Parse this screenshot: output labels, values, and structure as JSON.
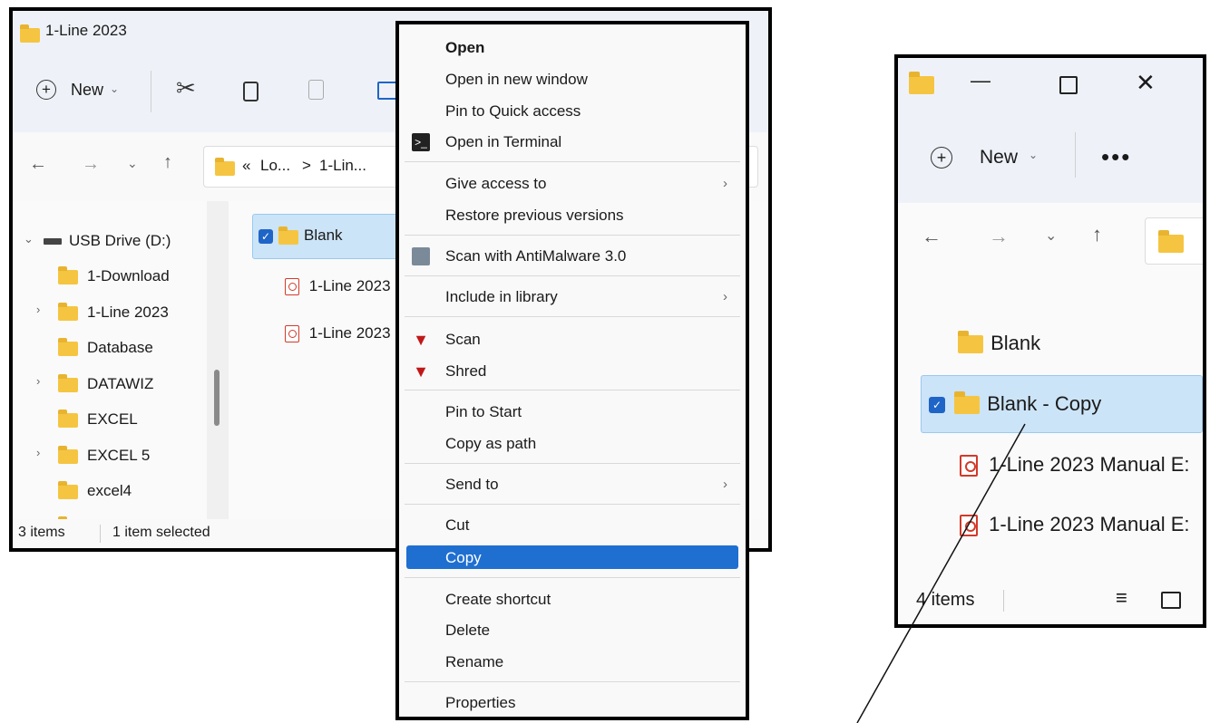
{
  "left_window": {
    "title": "1-Line 2023",
    "toolbar": {
      "new_label": "New"
    },
    "address": {
      "prefix": "«",
      "segment1": "Lo...",
      "separator": ">",
      "segment2": "1-Lin..."
    },
    "tree": [
      {
        "label": "USB Drive (D:)",
        "expandable": true,
        "expanded": true
      },
      {
        "label": "1-Download",
        "expandable": false
      },
      {
        "label": "1-Line 2023",
        "expandable": true
      },
      {
        "label": "Database",
        "expandable": false
      },
      {
        "label": "DATAWIZ",
        "expandable": true
      },
      {
        "label": "EXCEL",
        "expandable": false
      },
      {
        "label": "EXCEL 5",
        "expandable": true
      },
      {
        "label": "excel4",
        "expandable": false
      }
    ],
    "files": [
      {
        "name": "Blank",
        "type": "folder",
        "selected": true
      },
      {
        "name": "1-Line 2023",
        "type": "pdf"
      },
      {
        "name": "1-Line 2023",
        "type": "pdf"
      }
    ],
    "status": {
      "count": "3 items",
      "selected": "1 item selected"
    }
  },
  "context_menu": {
    "items": [
      {
        "label": "Open",
        "bold": true
      },
      {
        "label": "Open in new window"
      },
      {
        "label": "Pin to Quick access"
      },
      {
        "label": "Open in Terminal",
        "icon": "terminal-icon"
      },
      {
        "label": "Give access to",
        "submenu": true
      },
      {
        "label": "Restore previous versions"
      },
      {
        "label": "Scan with AntiMalware 3.0",
        "icon": "antimalware-icon"
      },
      {
        "label": "Include in library",
        "submenu": true
      },
      {
        "label": "Scan",
        "icon": "mcafee-icon"
      },
      {
        "label": "Shred",
        "icon": "mcafee-icon"
      },
      {
        "label": "Pin to Start"
      },
      {
        "label": "Copy as path"
      },
      {
        "label": "Send to",
        "submenu": true
      },
      {
        "label": "Cut"
      },
      {
        "label": "Copy",
        "highlighted": true
      },
      {
        "label": "Create shortcut"
      },
      {
        "label": "Delete"
      },
      {
        "label": "Rename"
      },
      {
        "label": "Properties"
      }
    ],
    "highlight_color": "#1f6fd0"
  },
  "right_window": {
    "toolbar": {
      "new_label": "New"
    },
    "files": [
      {
        "name": "Blank",
        "type": "folder"
      },
      {
        "name": "Blank - Copy",
        "type": "folder",
        "selected": true
      },
      {
        "name": "1-Line 2023 Manual E:",
        "type": "pdf"
      },
      {
        "name": "1-Line 2023 Manual E:",
        "type": "pdf"
      }
    ],
    "status": {
      "count": "4 items"
    }
  },
  "colors": {
    "accent": "#1f65c8",
    "folder": "#f5c542",
    "pdf": "#d23a2a",
    "selection": "#cce4f7"
  }
}
